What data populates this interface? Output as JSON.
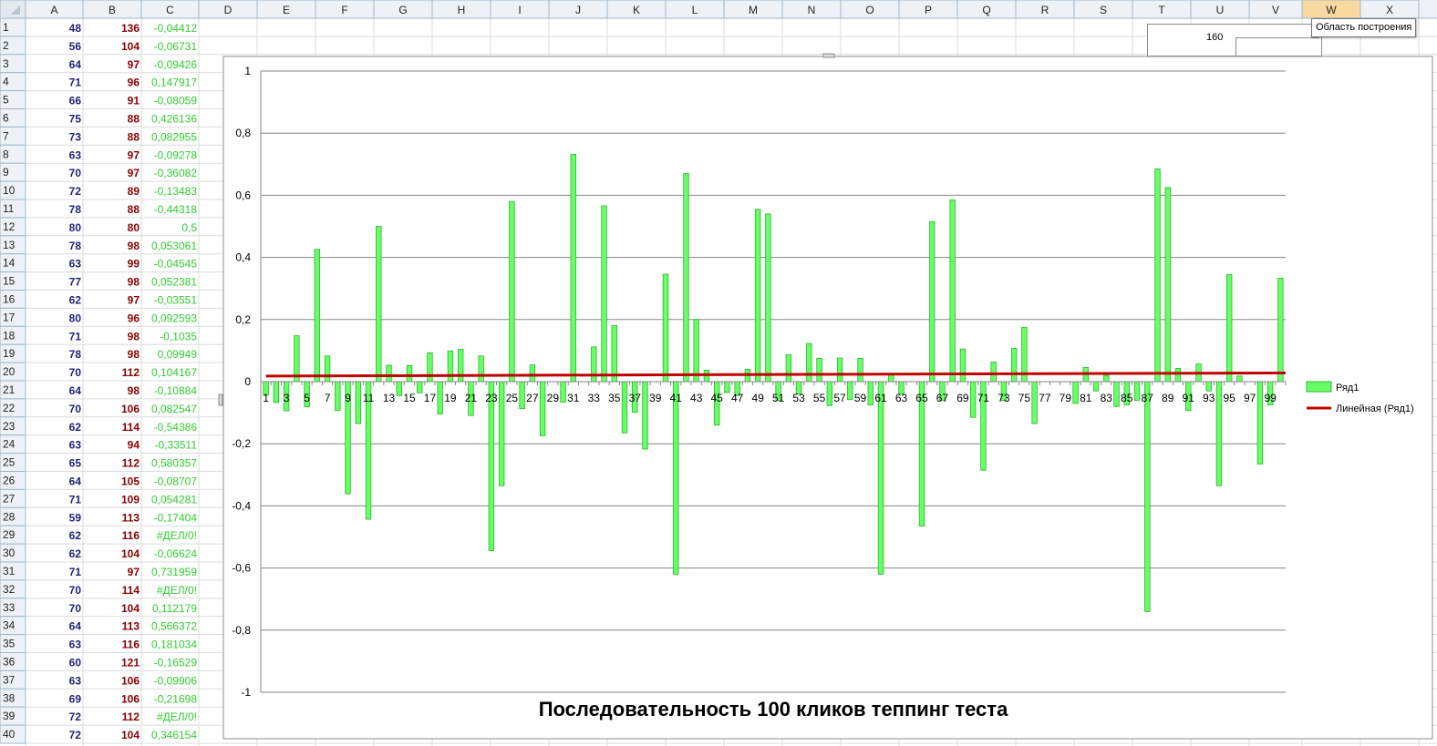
{
  "sheet": {
    "columns": [
      "A",
      "B",
      "C",
      "D",
      "E",
      "F",
      "G",
      "H",
      "I",
      "J",
      "K",
      "L",
      "M",
      "N",
      "O",
      "P",
      "Q",
      "R",
      "S",
      "T",
      "U",
      "V",
      "W",
      "X"
    ],
    "selected_column": "W",
    "colors": {
      "col_a": "#1f1f7a",
      "col_b": "#8b0000",
      "col_c": "#33cc33"
    },
    "rows": [
      {
        "n": "1",
        "a": "48",
        "b": "136",
        "c": "-0,04412"
      },
      {
        "n": "2",
        "a": "56",
        "b": "104",
        "c": "-0,06731"
      },
      {
        "n": "3",
        "a": "64",
        "b": "97",
        "c": "-0,09426"
      },
      {
        "n": "4",
        "a": "71",
        "b": "96",
        "c": "0,147917"
      },
      {
        "n": "5",
        "a": "66",
        "b": "91",
        "c": "-0,08059"
      },
      {
        "n": "6",
        "a": "75",
        "b": "88",
        "c": "0,426136"
      },
      {
        "n": "7",
        "a": "73",
        "b": "88",
        "c": "0,082955"
      },
      {
        "n": "8",
        "a": "63",
        "b": "97",
        "c": "-0,09278"
      },
      {
        "n": "9",
        "a": "70",
        "b": "97",
        "c": "-0,36082"
      },
      {
        "n": "10",
        "a": "72",
        "b": "89",
        "c": "-0,13483"
      },
      {
        "n": "11",
        "a": "78",
        "b": "88",
        "c": "-0,44318"
      },
      {
        "n": "12",
        "a": "80",
        "b": "80",
        "c": "0,5"
      },
      {
        "n": "13",
        "a": "78",
        "b": "98",
        "c": "0,053061"
      },
      {
        "n": "14",
        "a": "63",
        "b": "99",
        "c": "-0,04545"
      },
      {
        "n": "15",
        "a": "77",
        "b": "98",
        "c": "0,052381"
      },
      {
        "n": "16",
        "a": "62",
        "b": "97",
        "c": "-0,03551"
      },
      {
        "n": "17",
        "a": "80",
        "b": "96",
        "c": "0,092593"
      },
      {
        "n": "18",
        "a": "71",
        "b": "98",
        "c": "-0,1035"
      },
      {
        "n": "19",
        "a": "78",
        "b": "98",
        "c": "0,09949"
      },
      {
        "n": "20",
        "a": "70",
        "b": "112",
        "c": "0,104167"
      },
      {
        "n": "21",
        "a": "64",
        "b": "98",
        "c": "-0,10884"
      },
      {
        "n": "22",
        "a": "70",
        "b": "106",
        "c": "0,082547"
      },
      {
        "n": "23",
        "a": "62",
        "b": "114",
        "c": "-0,54386"
      },
      {
        "n": "24",
        "a": "63",
        "b": "94",
        "c": "-0,33511"
      },
      {
        "n": "25",
        "a": "65",
        "b": "112",
        "c": "0,580357"
      },
      {
        "n": "26",
        "a": "64",
        "b": "105",
        "c": "-0,08707"
      },
      {
        "n": "27",
        "a": "71",
        "b": "109",
        "c": "0,054281"
      },
      {
        "n": "28",
        "a": "59",
        "b": "113",
        "c": "-0,17404"
      },
      {
        "n": "29",
        "a": "62",
        "b": "116",
        "c": "#ДЕЛ/0!"
      },
      {
        "n": "30",
        "a": "62",
        "b": "104",
        "c": "-0,06624"
      },
      {
        "n": "31",
        "a": "71",
        "b": "97",
        "c": "0,731959"
      },
      {
        "n": "32",
        "a": "70",
        "b": "114",
        "c": "#ДЕЛ/0!"
      },
      {
        "n": "33",
        "a": "70",
        "b": "104",
        "c": "0,112179"
      },
      {
        "n": "34",
        "a": "64",
        "b": "113",
        "c": "0,566372"
      },
      {
        "n": "35",
        "a": "63",
        "b": "116",
        "c": "0,181034"
      },
      {
        "n": "36",
        "a": "60",
        "b": "121",
        "c": "-0,16529"
      },
      {
        "n": "37",
        "a": "63",
        "b": "106",
        "c": "-0,09906"
      },
      {
        "n": "38",
        "a": "69",
        "b": "106",
        "c": "-0,21698"
      },
      {
        "n": "39",
        "a": "72",
        "b": "112",
        "c": "#ДЕЛ/0!"
      },
      {
        "n": "40",
        "a": "72",
        "b": "104",
        "c": "0,346154"
      }
    ]
  },
  "tooltip": {
    "text": "Область построения"
  },
  "small_chart": {
    "label": "160"
  },
  "chart_data": {
    "type": "bar",
    "title": "Последовательность  100  кликов теппинг теста",
    "ylim": [
      -1,
      1
    ],
    "yticks": [
      "1",
      "0,8",
      "0,6",
      "0,4",
      "0,2",
      "0",
      "-0,2",
      "-0,4",
      "-0,6",
      "-0,8",
      "-1"
    ],
    "ytick_values": [
      1,
      0.8,
      0.6,
      0.4,
      0.2,
      0,
      -0.2,
      -0.4,
      -0.6,
      -0.8,
      -1
    ],
    "grid": true,
    "legend_position": "right",
    "categories": [
      1,
      2,
      3,
      4,
      5,
      6,
      7,
      8,
      9,
      10,
      11,
      12,
      13,
      14,
      15,
      16,
      17,
      18,
      19,
      20,
      21,
      22,
      23,
      24,
      25,
      26,
      27,
      28,
      29,
      30,
      31,
      32,
      33,
      34,
      35,
      36,
      37,
      38,
      39,
      40,
      41,
      42,
      43,
      44,
      45,
      46,
      47,
      48,
      49,
      50,
      51,
      52,
      53,
      54,
      55,
      56,
      57,
      58,
      59,
      60,
      61,
      62,
      63,
      64,
      65,
      66,
      67,
      68,
      69,
      70,
      71,
      72,
      73,
      74,
      75,
      76,
      77,
      78,
      79,
      80,
      81,
      82,
      83,
      84,
      85,
      86,
      87,
      88,
      89,
      90,
      91,
      92,
      93,
      94,
      95,
      96,
      97,
      98,
      99,
      100
    ],
    "xtick_labels": [
      "1",
      "3",
      "5",
      "7",
      "9",
      "11",
      "13",
      "15",
      "17",
      "19",
      "21",
      "23",
      "25",
      "27",
      "29",
      "31",
      "33",
      "35",
      "37",
      "39",
      "41",
      "43",
      "45",
      "47",
      "49",
      "51",
      "53",
      "55",
      "57",
      "59",
      "61",
      "63",
      "65",
      "67",
      "69",
      "71",
      "73",
      "75",
      "77",
      "79",
      "81",
      "83",
      "85",
      "87",
      "89",
      "91",
      "93",
      "95",
      "97",
      "99"
    ],
    "series": [
      {
        "name": "Ряд1",
        "color": "#66ff66",
        "values": [
          -0.044,
          -0.067,
          -0.094,
          0.148,
          -0.081,
          0.426,
          0.083,
          -0.093,
          -0.361,
          -0.135,
          -0.443,
          0.5,
          0.053,
          -0.045,
          0.052,
          -0.036,
          0.093,
          -0.104,
          0.099,
          0.104,
          -0.109,
          0.083,
          -0.544,
          -0.335,
          0.58,
          -0.087,
          0.054,
          -0.174,
          0,
          -0.066,
          0.732,
          0,
          0.112,
          0.566,
          0.181,
          -0.165,
          -0.099,
          -0.217,
          0,
          0.346,
          -0.62,
          0.67,
          0.2,
          0.037,
          -0.14,
          -0.035,
          -0.045,
          0.04,
          0.555,
          0.54,
          -0.06,
          0.087,
          -0.04,
          0.123,
          0.075,
          -0.077,
          0.076,
          -0.058,
          0.075,
          -0.075,
          -0.62,
          0.025,
          -0.04,
          0,
          -0.465,
          0.515,
          -0.06,
          0.585,
          0.105,
          -0.115,
          -0.285,
          0.063,
          -0.06,
          0.107,
          0.175,
          -0.135,
          0,
          0,
          0,
          -0.07,
          0.046,
          -0.03,
          0.02,
          -0.08,
          -0.075,
          -0.06,
          -0.74,
          0.685,
          0.625,
          0.043,
          -0.093,
          0.057,
          -0.03,
          -0.335,
          0.345,
          0.018,
          0,
          -0.265,
          -0.075,
          0.333
        ]
      }
    ],
    "trendline": {
      "name": "Линейная (Ряд1)",
      "color": "#c00000",
      "start": 0.018,
      "end": 0.028
    }
  }
}
